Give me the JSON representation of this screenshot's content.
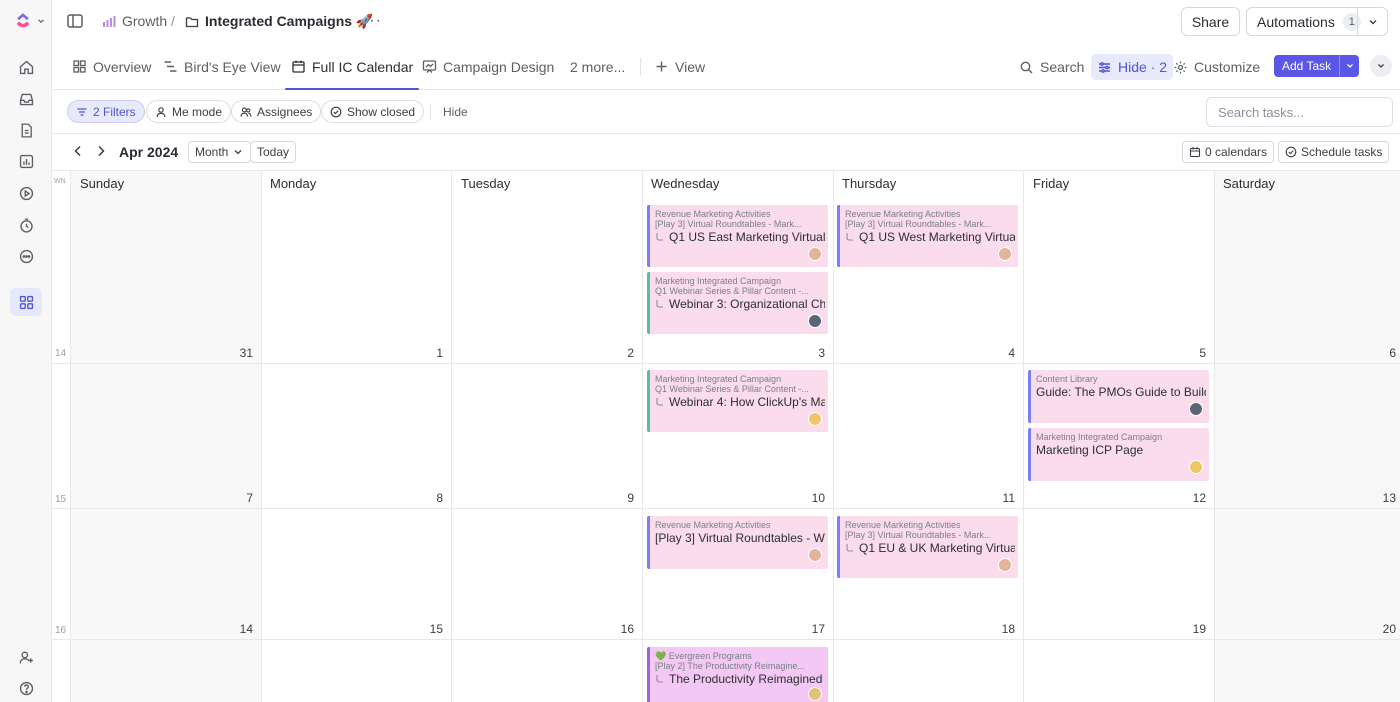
{
  "workspace": {
    "breadcrumb_growth": "Growth",
    "breadcrumb_separator": "/",
    "breadcrumb_folder": "Integrated Campaigns 🚀",
    "more": "···"
  },
  "header": {
    "share_label": "Share",
    "automations_label": "Automations",
    "automations_count": "1"
  },
  "tabs": [
    {
      "label": "Overview"
    },
    {
      "label": "Bird's Eye View"
    },
    {
      "label": "Full IC Calendar"
    },
    {
      "label": "Campaign Design"
    },
    {
      "label": "2 more..."
    },
    {
      "label": "View"
    }
  ],
  "tools": {
    "search_label": "Search",
    "hide_label": "Hide · 2",
    "customize_label": "Customize",
    "add_task_label": "Add Task"
  },
  "filters": {
    "filters_label": "2 Filters",
    "me_mode_label": "Me mode",
    "assignees_label": "Assignees",
    "show_closed_label": "Show closed",
    "hide_label": "Hide",
    "search_placeholder": "Search tasks..."
  },
  "calendar": {
    "month_label": "Apr 2024",
    "view_label": "Month",
    "today_label": "Today",
    "calendars_label": "0 calendars",
    "schedule_label": "Schedule tasks",
    "wn_label": "WN",
    "days": [
      "Sunday",
      "Monday",
      "Tuesday",
      "Wednesday",
      "Thursday",
      "Friday",
      "Saturday"
    ],
    "weeks": [
      {
        "wn": "14",
        "dates": [
          "31",
          "1",
          "2",
          "3",
          "4",
          "5",
          "6"
        ]
      },
      {
        "wn": "15",
        "dates": [
          "7",
          "8",
          "9",
          "10",
          "11",
          "12",
          "13"
        ]
      },
      {
        "wn": "16",
        "dates": [
          "14",
          "15",
          "16",
          "17",
          "18",
          "19",
          "20"
        ]
      }
    ],
    "events": [
      {
        "list": "Revenue Marketing Activities",
        "parent": "[Play 3] Virtual Roundtables - Mark...",
        "title": "Q1 US East Marketing Virtual"
      },
      {
        "list": "Marketing Integrated Campaign",
        "parent": "Q1 Webinar Series & Pillar Content -...",
        "title": "Webinar 3: Organizational Ch"
      },
      {
        "list": "Revenue Marketing Activities",
        "parent": "[Play 3] Virtual Roundtables - Mark...",
        "title": "Q1 US West Marketing Virtual"
      },
      {
        "list": "Marketing Integrated Campaign",
        "parent": "Q1 Webinar Series & Pillar Content -...",
        "title": "Webinar 4: How ClickUp's Ma"
      },
      {
        "list": "Content Library",
        "parent": "",
        "title": "Guide: The PMOs Guide to Build"
      },
      {
        "list": "Marketing Integrated Campaign",
        "parent": "",
        "title": "Marketing ICP Page"
      },
      {
        "list": "Revenue Marketing Activities",
        "parent": "",
        "title": "[Play 3] Virtual Roundtables - W"
      },
      {
        "list": "Revenue Marketing Activities",
        "parent": "[Play 3] Virtual Roundtables - Mark...",
        "title": "Q1 EU & UK Marketing Virtual"
      },
      {
        "list": "💚 Evergreen Programs",
        "parent": "[Play 2] The Productivity Reimagine...",
        "title": "The Productivity Reimagined"
      }
    ]
  }
}
